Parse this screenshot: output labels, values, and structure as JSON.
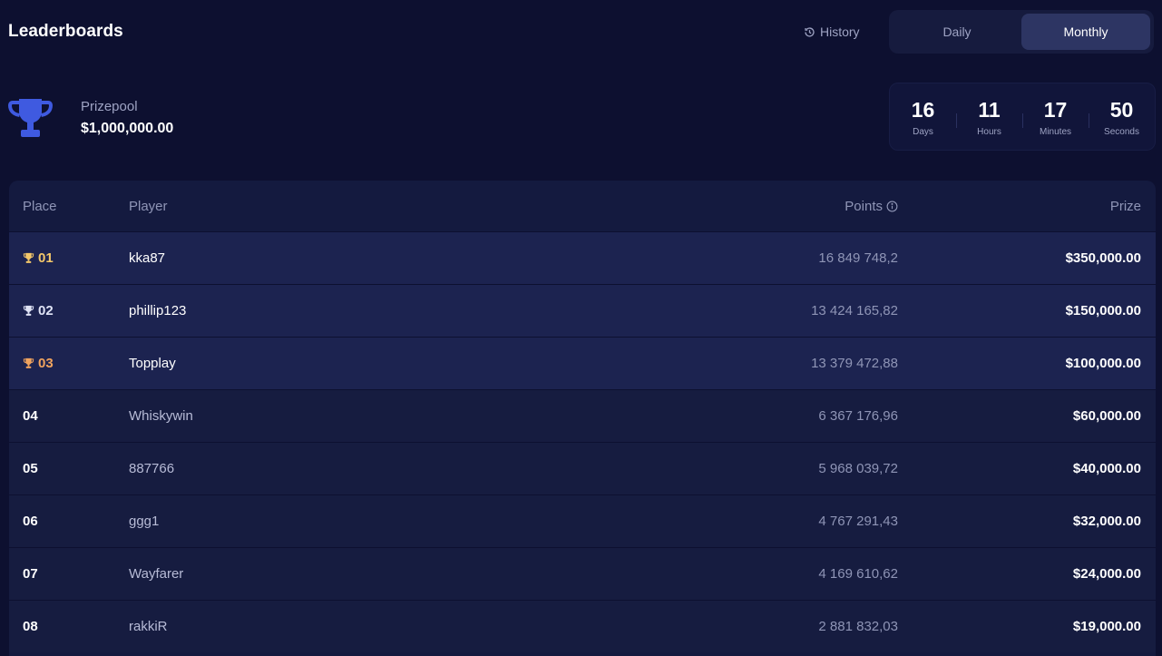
{
  "header": {
    "title": "Leaderboards",
    "history_label": "History",
    "toggle": [
      {
        "label": "Daily",
        "active": false
      },
      {
        "label": "Monthly",
        "active": true
      }
    ]
  },
  "prizepool": {
    "label": "Prizepool",
    "value": "$1,000,000.00"
  },
  "countdown": [
    {
      "value": "16",
      "unit": "Days"
    },
    {
      "value": "11",
      "unit": "Hours"
    },
    {
      "value": "17",
      "unit": "Minutes"
    },
    {
      "value": "50",
      "unit": "Seconds"
    }
  ],
  "table": {
    "headers": {
      "place": "Place",
      "player": "Player",
      "points": "Points",
      "prize": "Prize"
    },
    "rows": [
      {
        "place": "01",
        "player": "kka87",
        "points": "16 849 748,2",
        "prize": "$350,000.00",
        "medal": "gold"
      },
      {
        "place": "02",
        "player": "phillip123",
        "points": "13 424 165,82",
        "prize": "$150,000.00",
        "medal": "silver"
      },
      {
        "place": "03",
        "player": "Topplay",
        "points": "13 379 472,88",
        "prize": "$100,000.00",
        "medal": "bronze"
      },
      {
        "place": "04",
        "player": "Whiskywin",
        "points": "6 367 176,96",
        "prize": "$60,000.00",
        "medal": ""
      },
      {
        "place": "05",
        "player": "887766",
        "points": "5 968 039,72",
        "prize": "$40,000.00",
        "medal": ""
      },
      {
        "place": "06",
        "player": "ggg1",
        "points": "4 767 291,43",
        "prize": "$32,000.00",
        "medal": ""
      },
      {
        "place": "07",
        "player": "Wayfarer",
        "points": "4 169 610,62",
        "prize": "$24,000.00",
        "medal": ""
      },
      {
        "place": "08",
        "player": "rakkiR",
        "points": "2 881 832,03",
        "prize": "$19,000.00",
        "medal": ""
      }
    ]
  },
  "colors": {
    "background": "#0d1030",
    "accent": "#3f5ae0",
    "gold": "#f3c76a",
    "silver": "#dfe3f5",
    "bronze": "#f0a35e"
  },
  "icons": {
    "history": "history-clock-icon",
    "prizepool": "trophy-icon",
    "points_info": "info-icon",
    "medal": "trophy-cup-icon"
  }
}
